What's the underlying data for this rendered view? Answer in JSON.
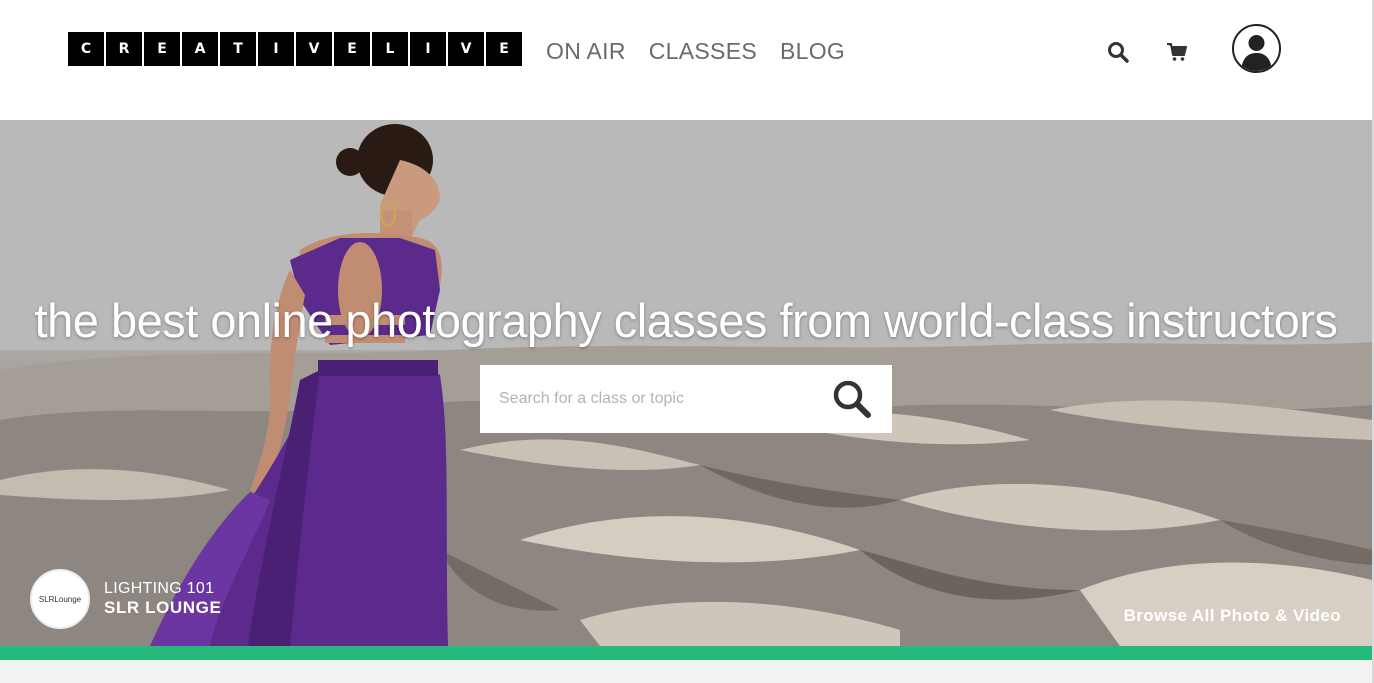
{
  "brand": {
    "letters": [
      "C",
      "R",
      "E",
      "A",
      "T",
      "I",
      "V",
      "E",
      "L",
      "I",
      "V",
      "E"
    ]
  },
  "nav": {
    "items": [
      {
        "label": "ON AIR"
      },
      {
        "label": "CLASSES"
      },
      {
        "label": "BLOG"
      }
    ]
  },
  "header_icons": [
    "search-icon",
    "cart-icon",
    "user-avatar-icon"
  ],
  "hero": {
    "headline": "the best online photography classes from world-class instructors",
    "search": {
      "placeholder": "Search for a class or topic",
      "value": ""
    },
    "instructor": {
      "course": "LIGHTING 101",
      "name": "SLR LOUNGE",
      "badge_text": "SLRLounge"
    },
    "browse_link": "Browse All Photo & Video"
  },
  "colors": {
    "accent": "#25b97b",
    "dress": "#5b2a8c",
    "logo_bg": "#000000",
    "nav_text": "#6a6a6a"
  }
}
